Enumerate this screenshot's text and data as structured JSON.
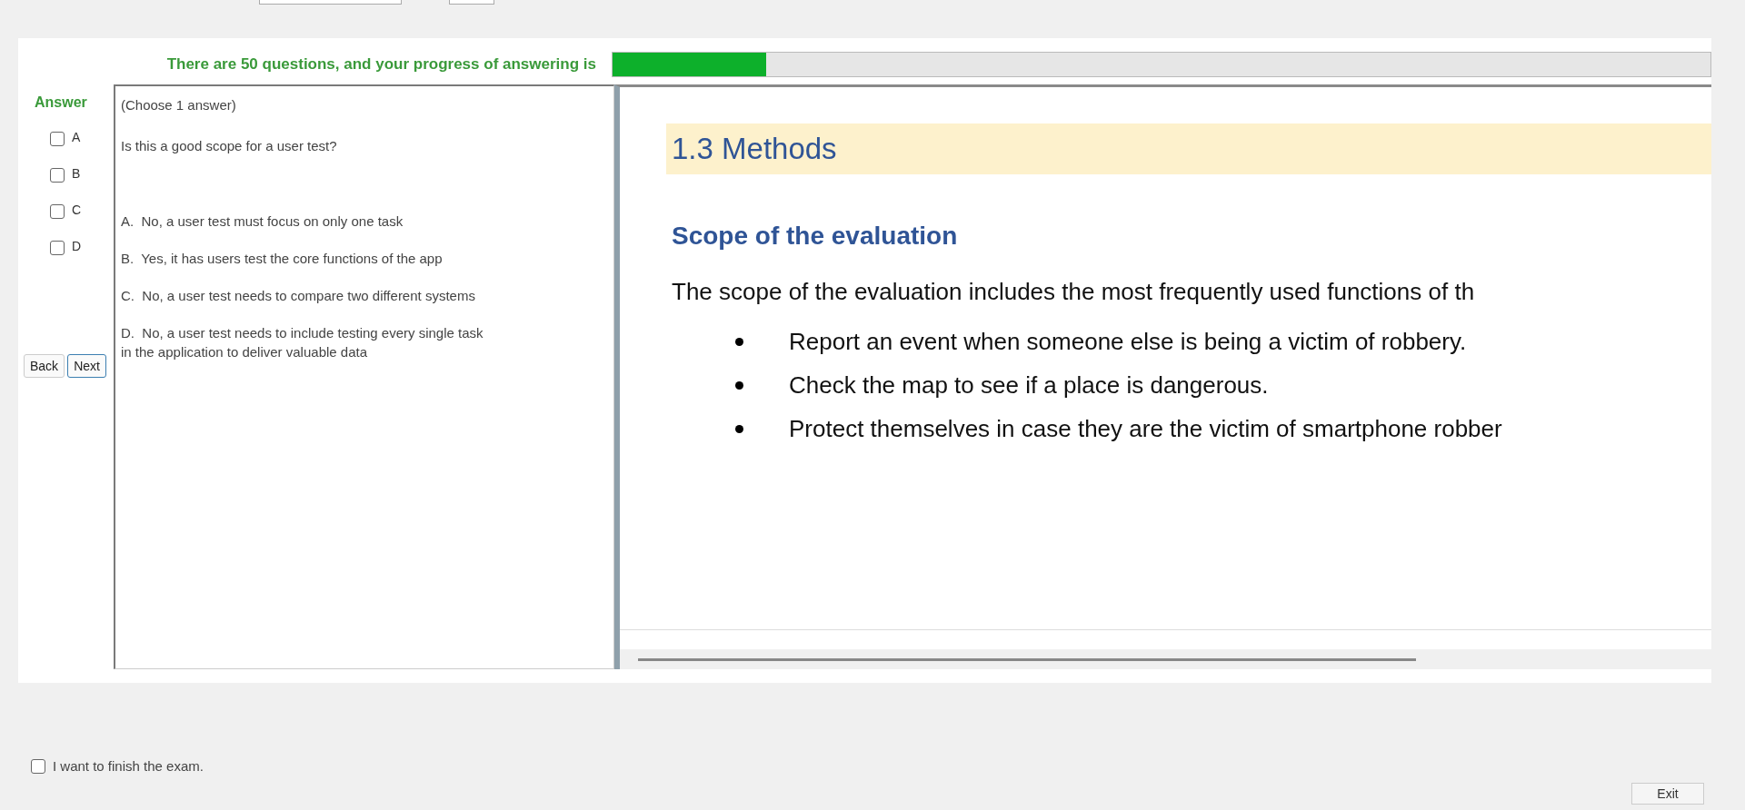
{
  "progress": {
    "text": "There are 50 questions, and your progress of answering is",
    "level": 0.14
  },
  "answer": {
    "label": "Answer",
    "options": [
      {
        "label": "A",
        "checked": false
      },
      {
        "label": "B",
        "checked": false
      },
      {
        "label": "C",
        "checked": false
      },
      {
        "label": "D",
        "checked": false
      }
    ]
  },
  "nav_buttons": [
    {
      "label": "Back",
      "focused": false
    },
    {
      "label": "Next",
      "focused": true
    }
  ],
  "question": {
    "instruction": "(Choose 1 answer)",
    "text": "Is this a good scope for a user test?",
    "choices": [
      "A.  No, a user test must focus on only one task",
      "B.  Yes, it has users test the core functions of the app",
      "C.  No, a user test needs to compare two different systems",
      "D.  No, a user test needs to include testing every single task in the application to deliver valuable data"
    ]
  },
  "slide": {
    "heading": "1.3 Methods",
    "subheading": "Scope of the evaluation",
    "paragraph": "The scope of the evaluation includes the most frequently used functions of th",
    "bullets": [
      "Report an event when someone else is being a victim of robbery.",
      "Check the map to see if a place is dangerous.",
      "Protect themselves in case they are the victim of smartphone robber"
    ]
  },
  "finish": {
    "label": "I want to finish the exam.",
    "checked": false
  },
  "exit_button": "Exit"
}
